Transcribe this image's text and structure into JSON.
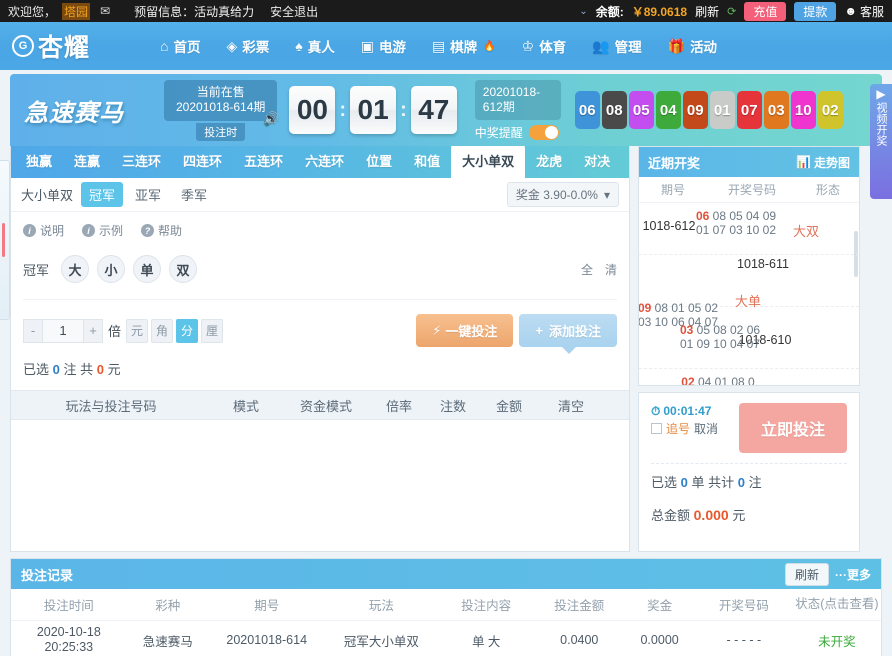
{
  "topbar": {
    "welcome": "欢迎您，",
    "username": "塔园",
    "mail_icon": "mail-icon",
    "notice": "预留信息：活动真给力",
    "logout": "安全退出",
    "caret": "⌄",
    "balance_label": "余额:",
    "balance_value": "￥89.0618",
    "refresh": "刷新",
    "refresh_icon": "refresh-icon",
    "recharge": "充值",
    "withdraw": "提款",
    "service": "客服",
    "service_icon": "headset-icon"
  },
  "nav": {
    "logo_mark": "G",
    "logo_text": "杏耀",
    "items": [
      {
        "icon": "home-icon",
        "glyph": "⌂",
        "label": "首页"
      },
      {
        "icon": "lottery-icon",
        "glyph": "◈",
        "label": "彩票"
      },
      {
        "icon": "live-icon",
        "glyph": "♠",
        "label": "真人"
      },
      {
        "icon": "game-icon",
        "glyph": "▣",
        "label": "电游"
      },
      {
        "icon": "chess-icon",
        "glyph": "▤",
        "label": "棋牌",
        "badge": "🔥"
      },
      {
        "icon": "sports-icon",
        "glyph": "♔",
        "label": "体育"
      },
      {
        "icon": "manage-icon",
        "glyph": "👥",
        "label": "管理"
      },
      {
        "icon": "activity-icon",
        "glyph": "🎁",
        "label": "活动"
      }
    ]
  },
  "gamehead": {
    "game_name": "急速赛马",
    "current_label": "当前在售",
    "current_issue": "20201018-614期",
    "phase_label": "投注时",
    "sound_icon": "speaker-icon",
    "countdown": {
      "h": "00",
      "m": "01",
      "s": "47",
      "sep": ":"
    },
    "prev_issue": "20201018-612期",
    "remind_label": "中奖提醒",
    "remind_on": true,
    "balls": [
      {
        "n": "06",
        "color": "#3f93d9"
      },
      {
        "n": "08",
        "color": "#4a4a4a"
      },
      {
        "n": "05",
        "color": "#c44df0"
      },
      {
        "n": "04",
        "color": "#3faa3c"
      },
      {
        "n": "09",
        "color": "#c4491a"
      },
      {
        "n": "01",
        "color": "#c9cbc9"
      },
      {
        "n": "07",
        "color": "#e5343a"
      },
      {
        "n": "03",
        "color": "#e07820"
      },
      {
        "n": "10",
        "color": "#ef35cd"
      },
      {
        "n": "02",
        "color": "#cfc42c"
      }
    ],
    "video_tab": {
      "icon": "play-circle-icon",
      "label": "视频开奖"
    }
  },
  "playtabs": [
    {
      "label": "独赢",
      "active": false
    },
    {
      "label": "连赢",
      "active": false
    },
    {
      "label": "三连环",
      "active": false
    },
    {
      "label": "四连环",
      "active": false
    },
    {
      "label": "五连环",
      "active": false
    },
    {
      "label": "六连环",
      "active": false
    },
    {
      "label": "位置",
      "active": false
    },
    {
      "label": "和值",
      "active": false
    },
    {
      "label": "大小单双",
      "active": true
    },
    {
      "label": "龙虎",
      "active": false
    },
    {
      "label": "对决",
      "active": false
    }
  ],
  "subtabs": {
    "label": "大小单双",
    "items": [
      {
        "label": "冠军",
        "active": true
      },
      {
        "label": "亚军",
        "active": false
      },
      {
        "label": "季军",
        "active": false
      }
    ],
    "prize": "奖金 3.90-0.0%",
    "prize_caret": "▾"
  },
  "helprow": [
    {
      "icon": "info-icon",
      "glyph": "i",
      "label": "说明"
    },
    {
      "icon": "info-icon",
      "glyph": "i",
      "label": "示例"
    },
    {
      "icon": "question-icon",
      "glyph": "?",
      "label": "帮助"
    }
  ],
  "options": {
    "row_label": "冠军",
    "buttons": [
      "大",
      "小",
      "单",
      "双"
    ],
    "select_all": "全",
    "clear": "清"
  },
  "multiplier": {
    "minus": "-",
    "value": "1",
    "plus": "+",
    "unit_word": "倍",
    "units": [
      {
        "label": "元",
        "active": false
      },
      {
        "label": "角",
        "active": false
      },
      {
        "label": "分",
        "active": true
      },
      {
        "label": "厘",
        "active": false
      }
    ],
    "onekey": "一键投注",
    "onekey_icon": "lightning-icon",
    "add": "添加投注",
    "add_icon": "plus-icon"
  },
  "selected_info": {
    "prefix": "已选",
    "count": "0",
    "mid": "注 共",
    "amount": "0",
    "suffix": "元"
  },
  "cart_columns": [
    "玩法与投注号码",
    "模式",
    "资金模式",
    "倍率",
    "注数",
    "金额",
    "清空"
  ],
  "recent": {
    "title": "近期开奖",
    "trend": "走势图",
    "trend_icon": "chart-icon",
    "columns": [
      "期号",
      "开奖号码",
      "形态"
    ],
    "rows": [
      {
        "issue": "1018-612",
        "highlight": "06",
        "numbers": "08 05 04 09 01 07 03 10 02",
        "form": "大双"
      },
      {
        "issue": "1018-611",
        "highlight": "09",
        "numbers": "08 01 05 02 03 10 06 04 07",
        "form": "大单"
      },
      {
        "issue": "1018-610",
        "highlight": "03",
        "numbers": "05 08 02 06 01 09 10 04 07",
        "form": ""
      },
      {
        "issue": "",
        "highlight": "02",
        "numbers": "04 01 08 0",
        "form": ""
      }
    ]
  },
  "betpanel": {
    "timer_icon": "clock-icon",
    "timer": "00:01:47",
    "chase": "追号",
    "cancel": "取消",
    "bet_now": "立即投注",
    "line1_prefix": "已选",
    "line1_count": "0",
    "line1_mid": "单 共计",
    "line1_count2": "0",
    "line1_suffix": "注",
    "total_label": "总金额",
    "total_value": "0.000",
    "total_unit": "元"
  },
  "records": {
    "title": "投注记录",
    "refresh": "刷新",
    "more": "···更多",
    "columns": [
      "投注时间",
      "彩种",
      "期号",
      "玩法",
      "投注内容",
      "投注金额",
      "奖金",
      "开奖号码",
      "状态(点击查看)"
    ],
    "rows": [
      {
        "time": "2020-10-18 20:25:33",
        "lottery": "急速赛马",
        "issue": "20201018-614",
        "play": "冠军大小单双",
        "content": "单 大",
        "amount": "0.0400",
        "prize": "0.0000",
        "numbers": "- - - - -",
        "status": "未开奖"
      }
    ]
  }
}
